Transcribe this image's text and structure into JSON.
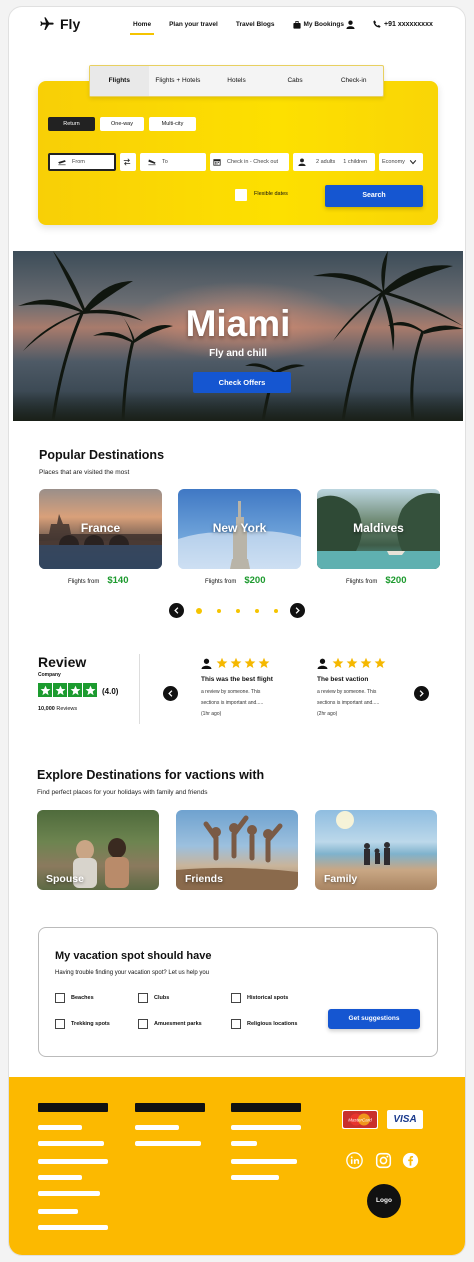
{
  "brand": {
    "name": "Fly"
  },
  "nav": {
    "links": [
      "Home",
      "Plan your travel",
      "Travel Blogs",
      "My Bookings"
    ],
    "phone": "+91 xxxxxxxxx",
    "active": "Home"
  },
  "search": {
    "tabs": [
      "Flights",
      "Flights + Hotels",
      "Hotels",
      "Cabs",
      "Check-in"
    ],
    "selected_tab": "Flights",
    "trip_types": [
      "Return",
      "One-way",
      "Multi-city"
    ],
    "selected_trip": "Return",
    "from_placeholder": "From",
    "to_placeholder": "To",
    "dates_placeholder": "Check in - Check out",
    "adults": "2 adults",
    "children": "1 children",
    "cabin": "Economy",
    "flexible_label": "Flexible dates",
    "search_label": "Search"
  },
  "hero": {
    "title": "Miami",
    "subtitle": "Fly and chill",
    "cta": "Check Offers"
  },
  "popular": {
    "title": "Popular Destinations",
    "subtitle": "Places that are visited the most",
    "price_prefix": "Flights from",
    "items": [
      {
        "name": "France",
        "price": "$140"
      },
      {
        "name": "New York",
        "price": "$200"
      },
      {
        "name": "Maldives",
        "price": "$200"
      }
    ],
    "carousel_active": 1
  },
  "review": {
    "title": "Review",
    "company": "Company",
    "rating": "(4.0)",
    "count": "10,000",
    "count_suffix": "Reviews",
    "cards": [
      {
        "title": "This was the best flight",
        "line1": "a review by someone. This",
        "line2": "sections is important and.....",
        "ago": "(1hr ago)"
      },
      {
        "title": "The best vaction",
        "line1": "a review by someone. This",
        "line2": "sections is important and.....",
        "ago": "(2hr ago)"
      }
    ]
  },
  "explore": {
    "title": "Explore Destinations for vactions with",
    "subtitle": "Find perfect places for your holidays with family and friends",
    "items": [
      "Spouse",
      "Friends",
      "Family"
    ]
  },
  "vacation": {
    "title": "My vacation spot should have",
    "subtitle": "Having trouble finding your vacation spot? Let us help you",
    "options": [
      "Beaches",
      "Clubs",
      "Historical spots",
      "Trekking spots",
      "Amuesment parks",
      "Religious locations"
    ],
    "button": "Get suggestions"
  },
  "footer": {
    "cards": [
      "MasterCard",
      "VISA"
    ],
    "social": [
      "linkedin-icon",
      "instagram-icon",
      "facebook-icon"
    ],
    "logo": "Logo"
  },
  "colors": {
    "accent": "#f5c400",
    "primary": "#1556d1",
    "price": "#1d9a2e",
    "footer": "#fcb900"
  }
}
